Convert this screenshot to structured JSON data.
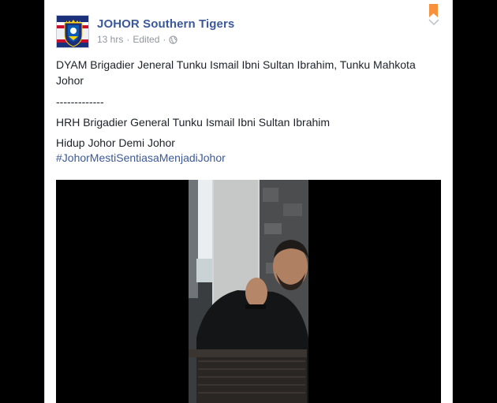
{
  "post": {
    "page_name": "JOHOR Southern Tigers",
    "time": "13 hrs",
    "edited": "Edited",
    "separator": "·",
    "lines": {
      "l1": "DYAM Brigadier Jeneral Tunku Ismail Ibni Sultan Ibrahim, Tunku Mahkota Johor",
      "l2": "-------------",
      "l3": "HRH Brigadier General Tunku Ismail Ibni Sultan Ibrahim",
      "l4": "Hidup Johor Demi Johor"
    },
    "hashtag": "#JohorMestiSentiasaMenjadiJohor"
  },
  "colors": {
    "link": "#3b5998",
    "meta": "#90949c",
    "bookmark": "#f7923a"
  },
  "icons": {
    "avatar": "jdt-crest-logo",
    "visibility": "globe-icon",
    "save": "bookmark-icon",
    "options": "chevron-down-icon"
  }
}
